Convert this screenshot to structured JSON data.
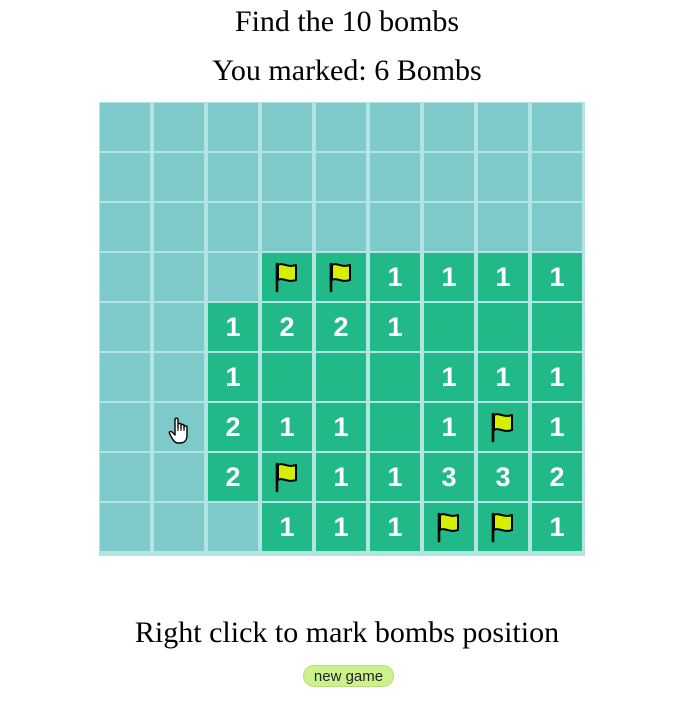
{
  "header": {
    "title": "Find the 10 bombs",
    "marked": "You marked: 6 Bombs"
  },
  "board": {
    "rows": 9,
    "cols": 9,
    "cells": [
      [
        "h",
        "h",
        "h",
        "h",
        "h",
        "h",
        "h",
        "h",
        "h"
      ],
      [
        "h",
        "h",
        "h",
        "h",
        "h",
        "h",
        "h",
        "h",
        "h"
      ],
      [
        "h",
        "h",
        "h",
        "h",
        "h",
        "h",
        "h",
        "h",
        "h"
      ],
      [
        "h",
        "h",
        "h",
        "F",
        "F",
        "1",
        "1",
        "1",
        "1"
      ],
      [
        "h",
        "h",
        "1",
        "2",
        "2",
        "1",
        "0",
        "0",
        "0"
      ],
      [
        "h",
        "h",
        "1",
        "0",
        "0",
        "0",
        "1",
        "1",
        "1"
      ],
      [
        "h",
        "h",
        "2",
        "1",
        "1",
        "0",
        "1",
        "F",
        "1"
      ],
      [
        "h",
        "h",
        "2",
        "F",
        "1",
        "1",
        "3",
        "3",
        "2"
      ],
      [
        "h",
        "h",
        "h",
        "1",
        "1",
        "1",
        "F",
        "F",
        "1"
      ]
    ],
    "colors": {
      "hidden": "#7ecaca",
      "open": "#22b989",
      "grid": "#b3e4e4",
      "flag": "#d4f000"
    }
  },
  "footer": {
    "hint": "Right click to mark bombs position",
    "new_game_label": "new game"
  },
  "cursor_icon": "hand-pointer-icon"
}
